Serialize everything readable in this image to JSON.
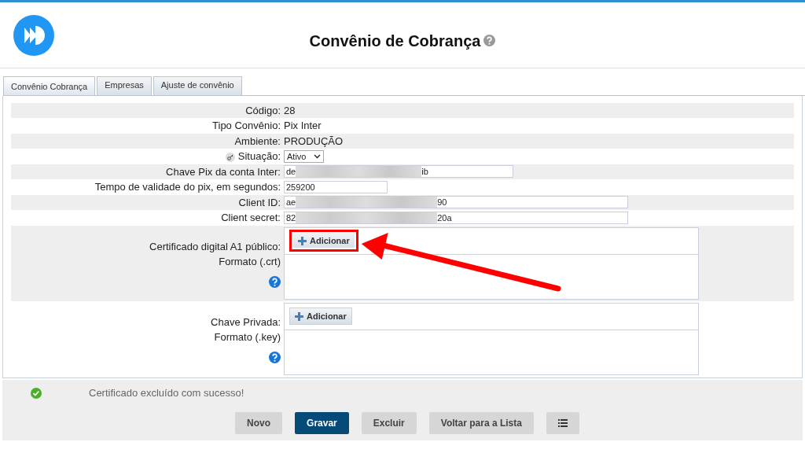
{
  "page_title": "Convênio de Cobrança",
  "tabs": [
    {
      "label": "Convênio Cobrança",
      "selected": true
    },
    {
      "label": "Empresas",
      "selected": false
    },
    {
      "label": "Ajuste de convênio",
      "selected": false
    }
  ],
  "fields": [
    {
      "kind": "text",
      "label": "Código:",
      "value": "28"
    },
    {
      "kind": "text",
      "label": "Tipo Convênio:",
      "value": "Pix Inter"
    },
    {
      "kind": "text",
      "label": "Ambiente:",
      "value": "PRODUÇÃO"
    },
    {
      "kind": "select",
      "label": "Situação:",
      "value": "Ativo"
    },
    {
      "kind": "input",
      "label": "Chave Pix da conta Inter:",
      "value_start": "de",
      "value_end": "ib"
    },
    {
      "kind": "input",
      "label": "Tempo de validade do pix, em segundos:",
      "value_start": "259200"
    },
    {
      "kind": "input",
      "label": "Client ID:",
      "value_start": "ae",
      "value_end": "90"
    },
    {
      "kind": "input",
      "label": "Client secret:",
      "value_start": "82",
      "value_end": "20a"
    },
    {
      "kind": "upload",
      "label": "Certificado digital A1 público:",
      "sublabel": "Formato (.crt)",
      "button": "Adicionar",
      "highlighted": true
    },
    {
      "kind": "upload",
      "label": "Chave Privada:",
      "sublabel": "Formato (.key)",
      "button": "Adicionar",
      "highlighted": false
    }
  ],
  "message": "Certificado excluído com sucesso!",
  "buttons": [
    {
      "label": "Novo",
      "primary": false
    },
    {
      "label": "Gravar",
      "primary": true
    },
    {
      "label": "Excluir",
      "primary": false
    },
    {
      "label": "Voltar para a Lista",
      "primary": false
    }
  ]
}
